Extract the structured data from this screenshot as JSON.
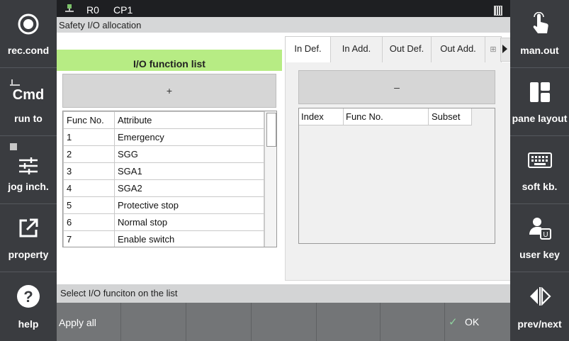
{
  "left_sidebar": [
    {
      "label": "rec.cond",
      "icon": "record-circle-icon"
    },
    {
      "label": "run to",
      "icon": "cmd-icon",
      "text": "Cmd"
    },
    {
      "label": "jog inch.",
      "icon": "sliders-icon"
    },
    {
      "label": "property",
      "icon": "external-link-icon"
    },
    {
      "label": "help",
      "icon": "help-circle-icon"
    }
  ],
  "right_sidebar": [
    {
      "label": "man.out",
      "icon": "hand-pointer-icon"
    },
    {
      "label": "pane layout",
      "icon": "layout-icon"
    },
    {
      "label": "soft kb.",
      "icon": "keyboard-icon"
    },
    {
      "label": "user key",
      "icon": "user-key-icon"
    },
    {
      "label": "prev/next",
      "icon": "prev-next-icon"
    }
  ],
  "topbar": {
    "robot": "R0",
    "program": "CP1"
  },
  "window": {
    "title": "Safety I/O allocation"
  },
  "function_list": {
    "header": "I/O function list",
    "add_label": "+",
    "columns": [
      "Func No.",
      "Attribute"
    ],
    "rows": [
      {
        "no": "1",
        "attr": "Emergency"
      },
      {
        "no": "2",
        "attr": "SGG"
      },
      {
        "no": "3",
        "attr": "SGA1"
      },
      {
        "no": "4",
        "attr": "SGA2"
      },
      {
        "no": "5",
        "attr": "Protective stop"
      },
      {
        "no": "6",
        "attr": "Normal stop"
      },
      {
        "no": "7",
        "attr": "Enable switch"
      }
    ]
  },
  "tabs": [
    {
      "label": "In Def.",
      "active": true
    },
    {
      "label": "In Add.",
      "active": false
    },
    {
      "label": "Out Def.",
      "active": false
    },
    {
      "label": "Out Add.",
      "active": false
    }
  ],
  "tab_panel": {
    "remove_label": "–",
    "columns": [
      "Index",
      "Func No.",
      "Subset"
    ]
  },
  "status": {
    "message": "Select I/O funciton on the list"
  },
  "bottom": {
    "apply_all": "Apply all",
    "ok": "OK"
  }
}
